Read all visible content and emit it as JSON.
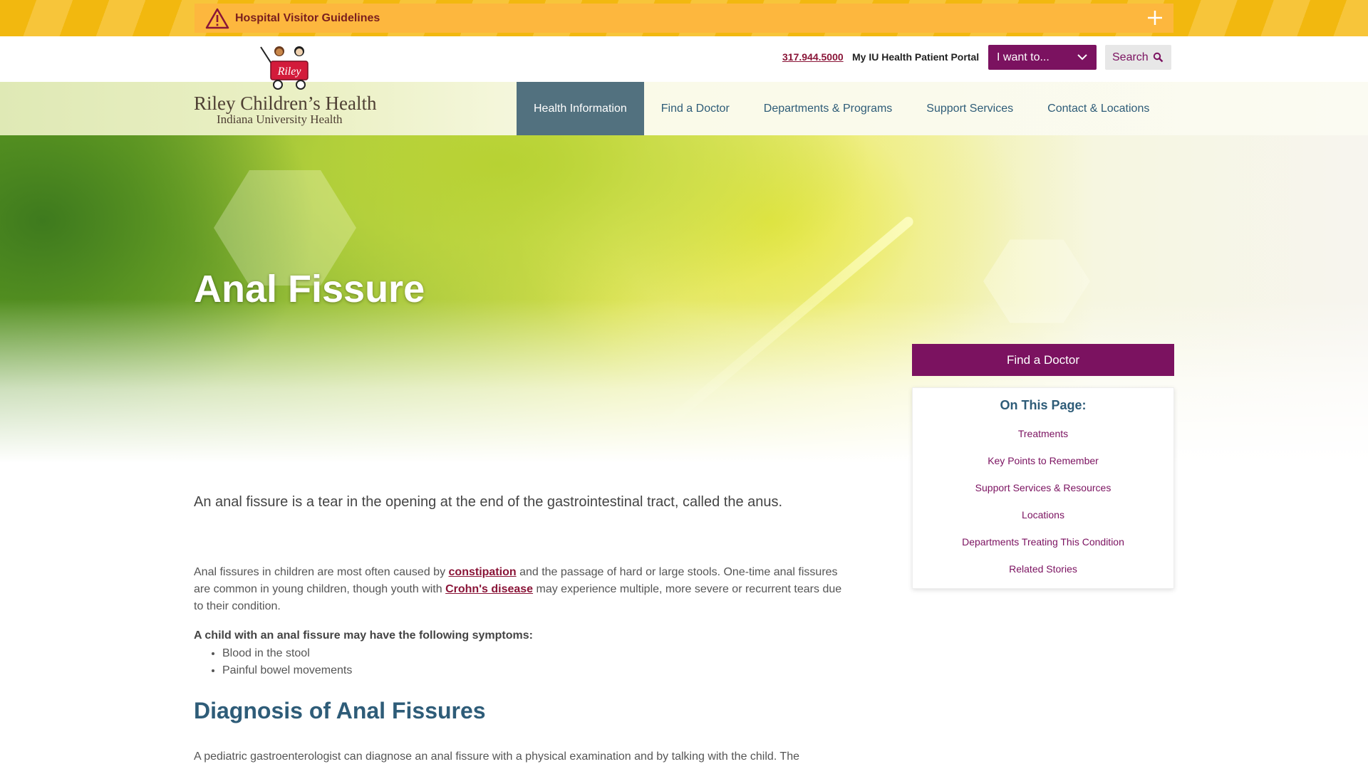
{
  "alert": {
    "title": "Hospital Visitor Guidelines",
    "icon": "warning-icon",
    "toggle_icon": "plus-icon"
  },
  "utility": {
    "phone": "317.944.5000",
    "portal": "My IU Health Patient Portal",
    "i_want": "I want to...",
    "search": "Search"
  },
  "logo": {
    "name": "Riley Children’s Health",
    "sub": "Indiana University Health",
    "cart_text": "Riley"
  },
  "nav": {
    "items": [
      {
        "label": "Health Information",
        "active": true
      },
      {
        "label": "Find a Doctor"
      },
      {
        "label": "Departments & Programs"
      },
      {
        "label": "Support Services"
      },
      {
        "label": "Contact & Locations"
      }
    ]
  },
  "hero": {
    "title": "Anal Fissure"
  },
  "sidebar": {
    "find_doctor": "Find a Doctor",
    "on_this_page": "On This Page:",
    "links": [
      "Treatments",
      "Key Points to Remember",
      "Support Services & Resources",
      "Locations",
      "Departments Treating This Condition",
      "Related Stories"
    ]
  },
  "content": {
    "intro": "An anal fissure is a tear in the opening at the end of the gastrointestinal tract, called the anus.",
    "para_1a": "Anal fissures in children are most often caused by ",
    "link_constipation": "constipation",
    "para_1b": " and the passage of hard or large stools. One-time anal fissures are common in young children, though youth with ",
    "link_crohns": "Crohn's disease",
    "para_1c": " may experience multiple, more severe or recurrent tears due to their condition.",
    "symptoms_heading": "A child with an anal fissure may have the following symptoms:",
    "symptoms": [
      "Blood in the stool",
      "Painful bowel movements"
    ],
    "section_title": "Diagnosis of Anal Fissures",
    "para_2": "A pediatric gastroenterologist can diagnose an anal fissure with a physical examination and by talking with the child. The"
  },
  "colors": {
    "brand_purple": "#7b1260",
    "nav_blue": "#2e5c78",
    "alert_yellow": "#fdb73e",
    "link_red": "#8a1538"
  }
}
